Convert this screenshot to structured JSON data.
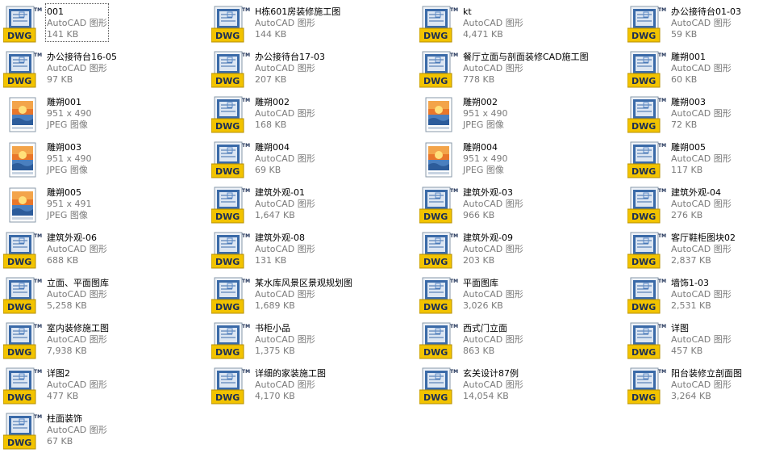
{
  "files": [
    {
      "name": "001",
      "type": "AutoCAD 图形",
      "size": "141 KB",
      "icon": "dwg-file-icon",
      "focused": true
    },
    {
      "name": "H栋601房装修施工图",
      "type": "AutoCAD 图形",
      "size": "144 KB",
      "icon": "dwg-file-icon"
    },
    {
      "name": "kt",
      "type": "AutoCAD 图形",
      "size": "4,471 KB",
      "icon": "dwg-file-icon"
    },
    {
      "name": "办公接待台01-03",
      "type": "AutoCAD 图形",
      "size": "59 KB",
      "icon": "dwg-file-icon"
    },
    {
      "name": "办公接待台16-05",
      "type": "AutoCAD 图形",
      "size": "97 KB",
      "icon": "dwg-file-icon"
    },
    {
      "name": "办公接待台17-03",
      "type": "AutoCAD 图形",
      "size": "207 KB",
      "icon": "dwg-file-icon"
    },
    {
      "name": "餐厅立面与剖面装修CAD施工图",
      "type": "AutoCAD 图形",
      "size": "778 KB",
      "icon": "dwg-file-icon"
    },
    {
      "name": "雕朔001",
      "type": "AutoCAD 图形",
      "size": "60 KB",
      "icon": "dwg-file-icon"
    },
    {
      "name": "雕朔001",
      "type": "951 x 490",
      "size": "JPEG 图像",
      "icon": "jpeg-file-icon"
    },
    {
      "name": "雕朔002",
      "type": "AutoCAD 图形",
      "size": "168 KB",
      "icon": "dwg-file-icon"
    },
    {
      "name": "雕朔002",
      "type": "951 x 490",
      "size": "JPEG 图像",
      "icon": "jpeg-file-icon"
    },
    {
      "name": "雕朔003",
      "type": "AutoCAD 图形",
      "size": "72 KB",
      "icon": "dwg-file-icon"
    },
    {
      "name": "雕朔003",
      "type": "951 x 490",
      "size": "JPEG 图像",
      "icon": "jpeg-file-icon"
    },
    {
      "name": "雕朔004",
      "type": "AutoCAD 图形",
      "size": "69 KB",
      "icon": "dwg-file-icon"
    },
    {
      "name": "雕朔004",
      "type": "951 x 490",
      "size": "JPEG 图像",
      "icon": "jpeg-file-icon"
    },
    {
      "name": "雕朔005",
      "type": "AutoCAD 图形",
      "size": "117 KB",
      "icon": "dwg-file-icon"
    },
    {
      "name": "雕朔005",
      "type": "951 x 491",
      "size": "JPEG 图像",
      "icon": "jpeg-file-icon"
    },
    {
      "name": "建筑外观-01",
      "type": "AutoCAD 图形",
      "size": "1,647 KB",
      "icon": "dwg-file-icon"
    },
    {
      "name": "建筑外观-03",
      "type": "AutoCAD 图形",
      "size": "966 KB",
      "icon": "dwg-file-icon"
    },
    {
      "name": "建筑外观-04",
      "type": "AutoCAD 图形",
      "size": "276 KB",
      "icon": "dwg-file-icon"
    },
    {
      "name": "建筑外观-06",
      "type": "AutoCAD 图形",
      "size": "688 KB",
      "icon": "dwg-file-icon"
    },
    {
      "name": "建筑外观-08",
      "type": "AutoCAD 图形",
      "size": "131 KB",
      "icon": "dwg-file-icon"
    },
    {
      "name": "建筑外观-09",
      "type": "AutoCAD 图形",
      "size": "203 KB",
      "icon": "dwg-file-icon"
    },
    {
      "name": "客厅鞋柜图块02",
      "type": "AutoCAD 图形",
      "size": "2,837 KB",
      "icon": "dwg-file-icon"
    },
    {
      "name": "立面、平面图库",
      "type": "AutoCAD 图形",
      "size": "5,258 KB",
      "icon": "dwg-file-icon"
    },
    {
      "name": "某水库风景区景观规划图",
      "type": "AutoCAD 图形",
      "size": "1,689 KB",
      "icon": "dwg-file-icon"
    },
    {
      "name": "平面图库",
      "type": "AutoCAD 图形",
      "size": "3,026 KB",
      "icon": "dwg-file-icon"
    },
    {
      "name": "墙饰1-03",
      "type": "AutoCAD 图形",
      "size": "2,531 KB",
      "icon": "dwg-file-icon"
    },
    {
      "name": "室内装修施工图",
      "type": "AutoCAD 图形",
      "size": "7,938 KB",
      "icon": "dwg-file-icon"
    },
    {
      "name": "书柜小品",
      "type": "AutoCAD 图形",
      "size": "1,375 KB",
      "icon": "dwg-file-icon"
    },
    {
      "name": "西式门立面",
      "type": "AutoCAD 图形",
      "size": "863 KB",
      "icon": "dwg-file-icon"
    },
    {
      "name": "详图",
      "type": "AutoCAD 图形",
      "size": "457 KB",
      "icon": "dwg-file-icon"
    },
    {
      "name": "详图2",
      "type": "AutoCAD 图形",
      "size": "477 KB",
      "icon": "dwg-file-icon"
    },
    {
      "name": "详细的家装施工图",
      "type": "AutoCAD 图形",
      "size": "4,170 KB",
      "icon": "dwg-file-icon"
    },
    {
      "name": "玄关设计87例",
      "type": "AutoCAD 图形",
      "size": "14,054 KB",
      "icon": "dwg-file-icon"
    },
    {
      "name": "阳台装修立剖面图",
      "type": "AutoCAD 图形",
      "size": "3,264 KB",
      "icon": "dwg-file-icon"
    },
    {
      "name": "柱面装饰",
      "type": "AutoCAD 图形",
      "size": "67 KB",
      "icon": "dwg-file-icon"
    }
  ],
  "icons": {
    "dwg_badge": "DWG",
    "tm_mark": "TM"
  },
  "colors": {
    "dwg_badge_bg": "#f2c300",
    "dwg_doc_blue": "#2f5f9f",
    "jpeg_sky": "#e9772b",
    "text_secondary": "#7b7b7b"
  }
}
